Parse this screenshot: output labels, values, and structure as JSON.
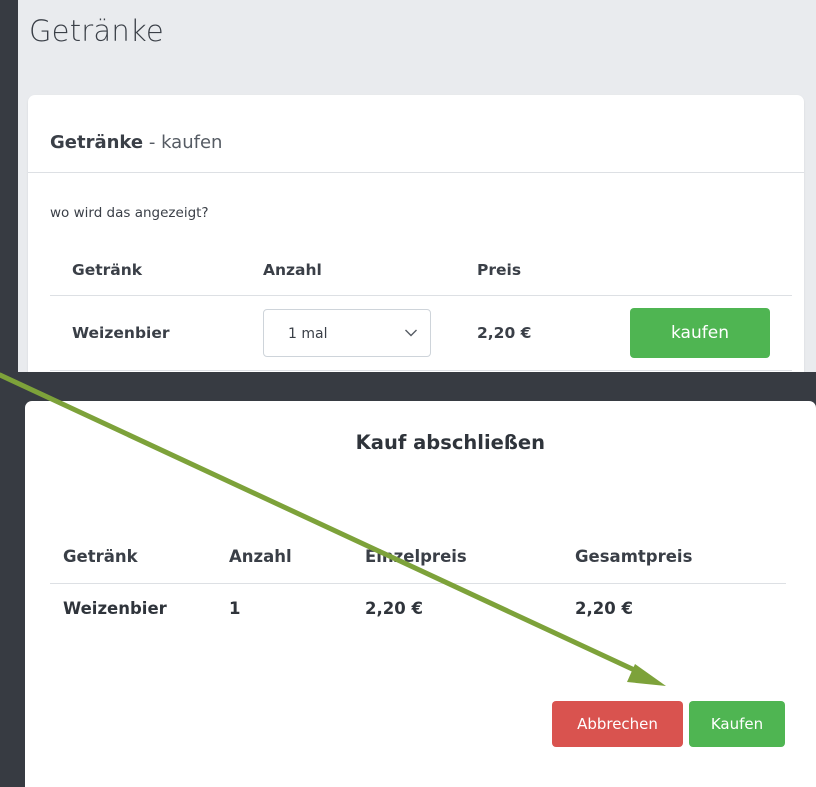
{
  "page": {
    "title": "Getränke"
  },
  "card": {
    "title_bold": "Getränke",
    "title_rest": " - kaufen",
    "note": "wo wird das angezeigt?",
    "columns": [
      "Getränk",
      "Anzahl",
      "Preis"
    ],
    "row": {
      "drink": "Weizenbier",
      "quantity_selected": "1 mal",
      "price": "2,20 €",
      "buy_label": "kaufen"
    }
  },
  "modal": {
    "title": "Kauf abschließen",
    "columns": [
      "Getränk",
      "Anzahl",
      "Einzelpreis",
      "Gesamtpreis"
    ],
    "row": {
      "drink": "Weizenbier",
      "quantity": "1",
      "unit_price": "2,20 €",
      "total_price": "2,20 €"
    },
    "cancel_label": "Abbrechen",
    "confirm_label": "Kaufen"
  },
  "colors": {
    "success": "#4fb552",
    "danger": "#d9534f",
    "annotation_arrow": "#7da23a",
    "backdrop": "#373b42"
  },
  "icons": {
    "select_chevron": "chevron-down-icon",
    "annotation": "arrow-annotation-icon"
  }
}
